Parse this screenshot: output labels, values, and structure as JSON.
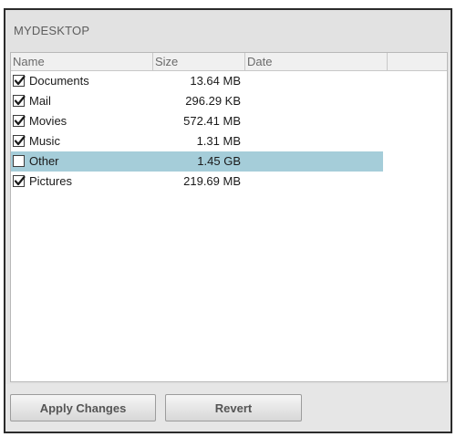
{
  "panel": {
    "title": "MYDESKTOP"
  },
  "columns": {
    "name": "Name",
    "size": "Size",
    "date": "Date"
  },
  "items": [
    {
      "name": "Documents",
      "size": "13.64 MB",
      "checked": true,
      "selected": false
    },
    {
      "name": "Mail",
      "size": "296.29 KB",
      "checked": true,
      "selected": false
    },
    {
      "name": "Movies",
      "size": "572.41 MB",
      "checked": true,
      "selected": false
    },
    {
      "name": "Music",
      "size": "1.31 MB",
      "checked": true,
      "selected": false
    },
    {
      "name": "Other",
      "size": "1.45 GB",
      "checked": false,
      "selected": true
    },
    {
      "name": "Pictures",
      "size": "219.69 MB",
      "checked": true,
      "selected": false
    }
  ],
  "buttons": {
    "apply": "Apply Changes",
    "revert": "Revert"
  },
  "colors": {
    "selected_row": "#a5cdd9"
  }
}
